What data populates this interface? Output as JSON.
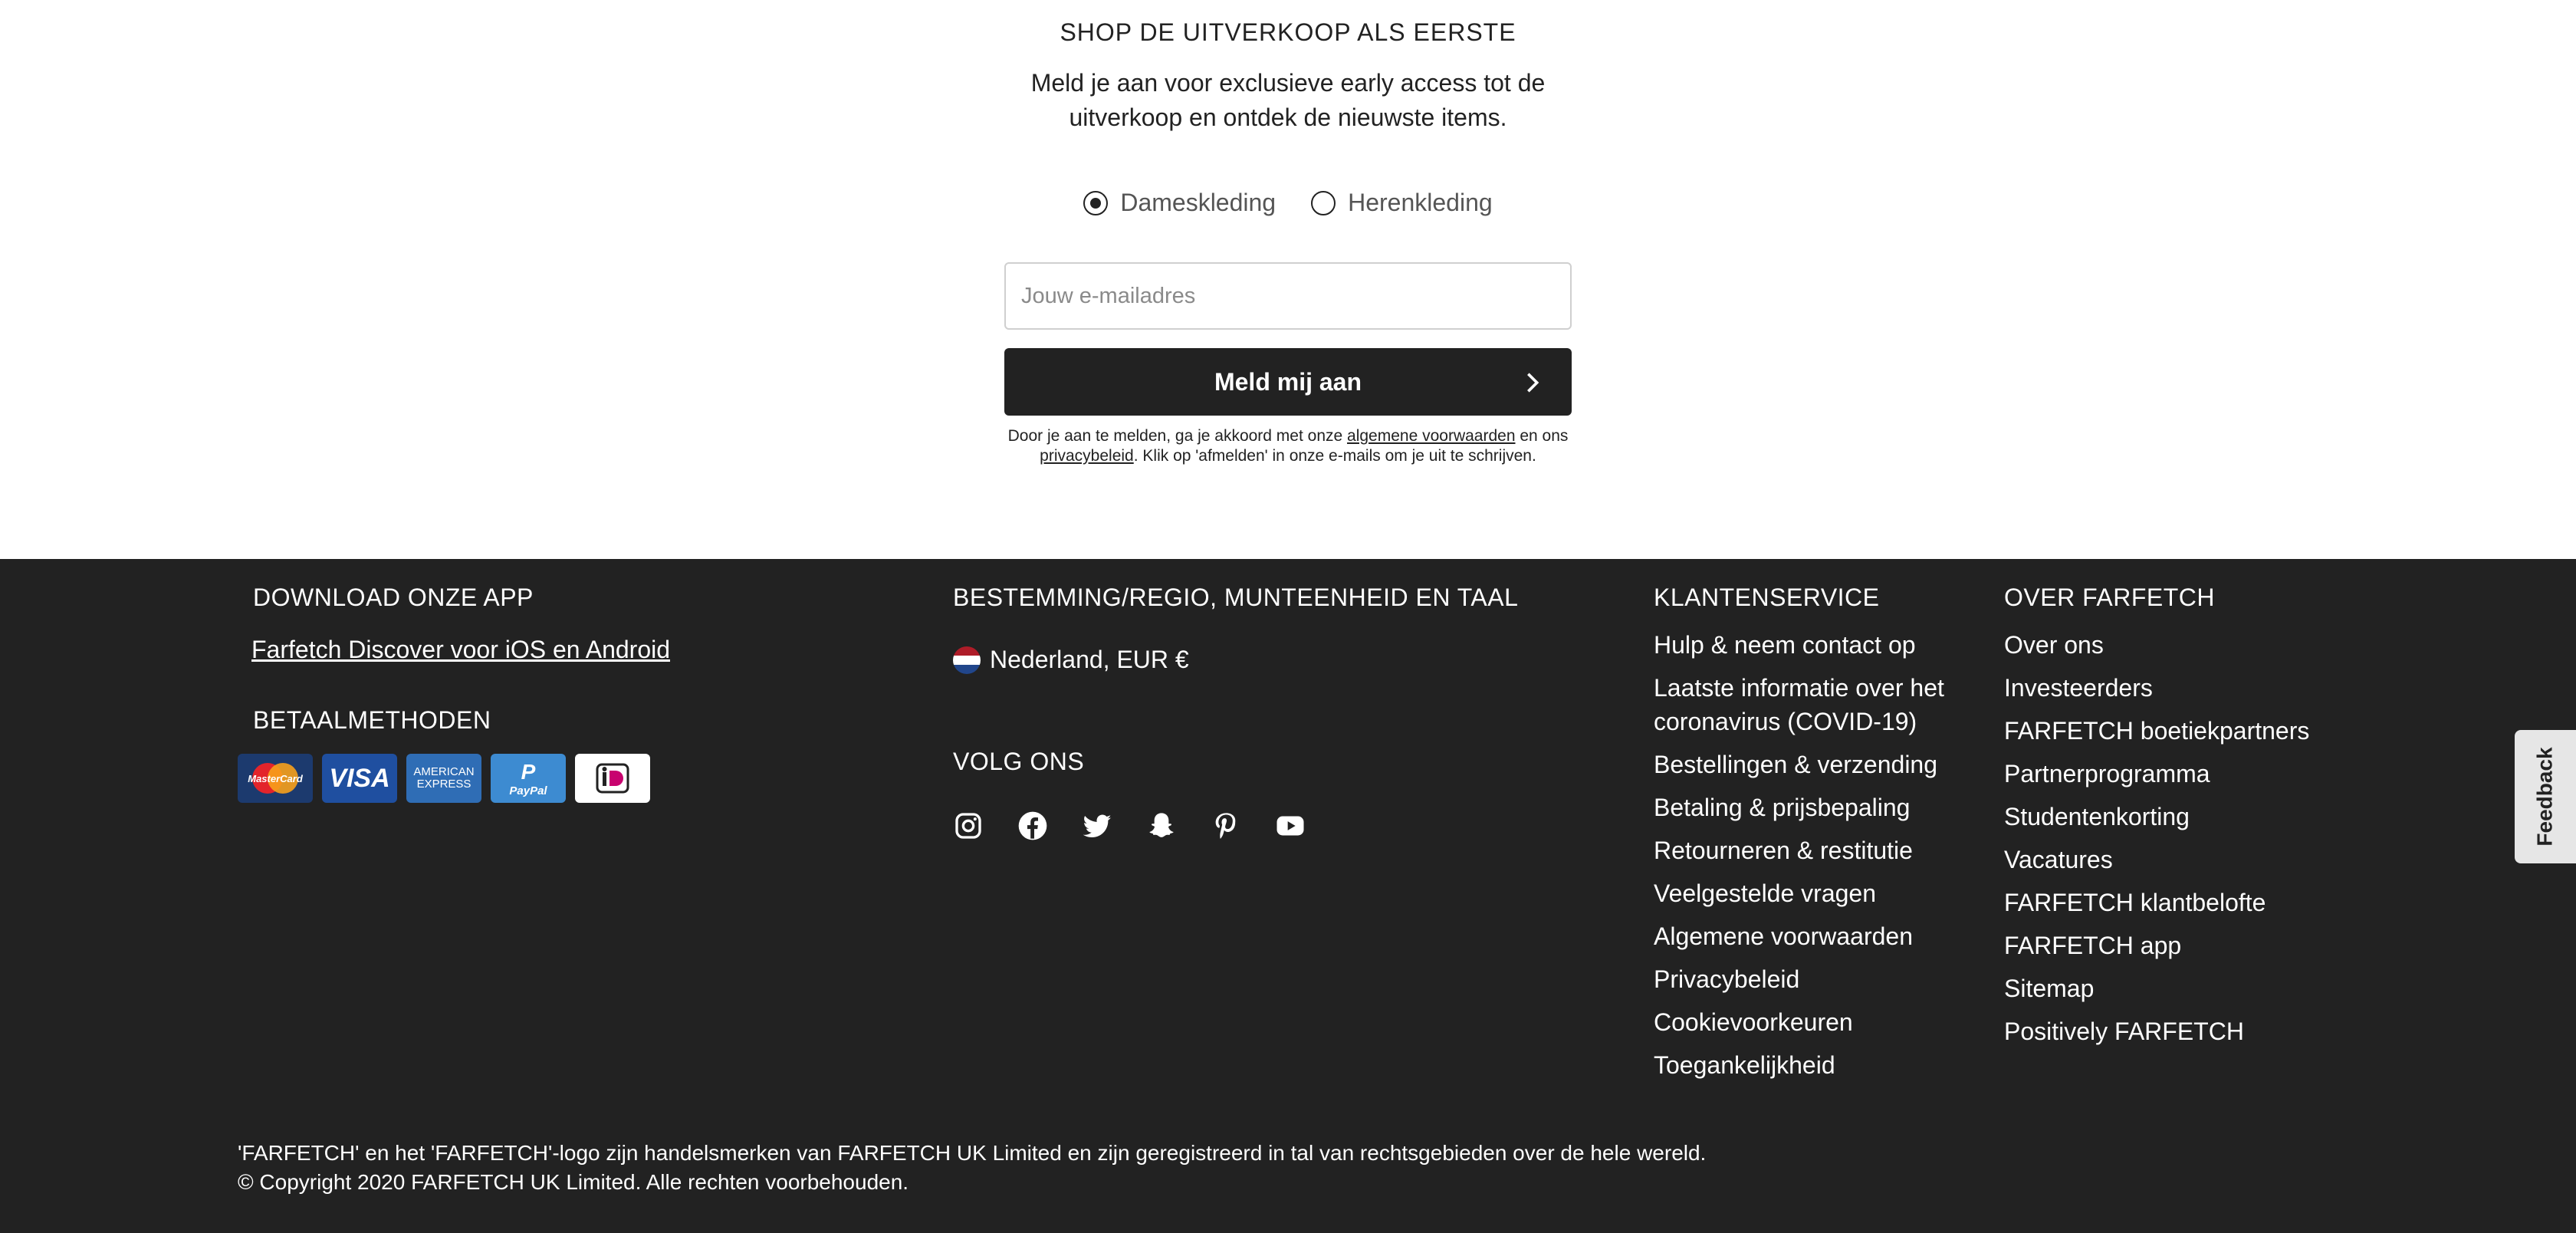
{
  "newsletter": {
    "title": "SHOP DE UITVERKOOP ALS EERSTE",
    "subtitle": "Meld je aan voor exclusieve early access tot de uitverkoop en ontdek de nieuwste items.",
    "radio_women": "Dameskleding",
    "radio_men": "Herenkleding",
    "selected": "Dameskleding",
    "email_placeholder": "Jouw e-mailadres",
    "email_value": "",
    "submit_label": "Meld mij aan",
    "legal_1": "Door je aan te melden, ga je akkoord met onze ",
    "legal_link_terms": "algemene voorwaarden",
    "legal_2": " en ons ",
    "legal_link_privacy": "privacybeleid",
    "legal_3": ". Klik op 'afmelden' in onze e-mails om je uit te schrijven."
  },
  "footer": {
    "app_heading": "DOWNLOAD ONZE APP",
    "app_link": "Farfetch Discover voor iOS en Android",
    "payment_heading": "BETAALMETHODEN",
    "payment_methods": [
      "MasterCard",
      "VISA",
      "AMERICAN EXPRESS",
      "PayPal",
      "iDEAL"
    ],
    "region_heading": "BESTEMMING/REGIO, MUNTEENHEID EN TAAL",
    "region_value": "Nederland, EUR €",
    "follow_heading": "VOLG ONS",
    "social_icons": [
      "instagram-icon",
      "facebook-icon",
      "twitter-icon",
      "snapchat-icon",
      "pinterest-icon",
      "youtube-icon"
    ],
    "service_heading": "KLANTENSERVICE",
    "service_links": [
      "Hulp & neem contact op",
      "Laatste informatie over het coronavirus (COVID-19)",
      "Bestellingen & verzending",
      "Betaling & prijsbepaling",
      "Retourneren & restitutie",
      "Veelgestelde vragen",
      "Algemene voorwaarden",
      "Privacybeleid",
      "Cookievoorkeuren",
      "Toegankelijkheid"
    ],
    "about_heading": "OVER FARFETCH",
    "about_links": [
      "Over ons",
      "Investeerders",
      "FARFETCH boetiekpartners",
      "Partnerprogramma",
      "Studentenkorting",
      "Vacatures",
      "FARFETCH klantbelofte",
      "FARFETCH app",
      "Sitemap",
      "Positively FARFETCH"
    ],
    "trademark": "'FARFETCH' en het 'FARFETCH'-logo zijn handelsmerken van FARFETCH UK Limited en zijn geregistreerd in tal van rechtsgebieden over de hele wereld.",
    "copyright": "© Copyright 2020 FARFETCH UK Limited. Alle rechten voorbehouden."
  },
  "feedback_label": "Feedback",
  "colors": {
    "footer_bg": "#222222",
    "button_bg": "#222222",
    "text": "#222222"
  }
}
